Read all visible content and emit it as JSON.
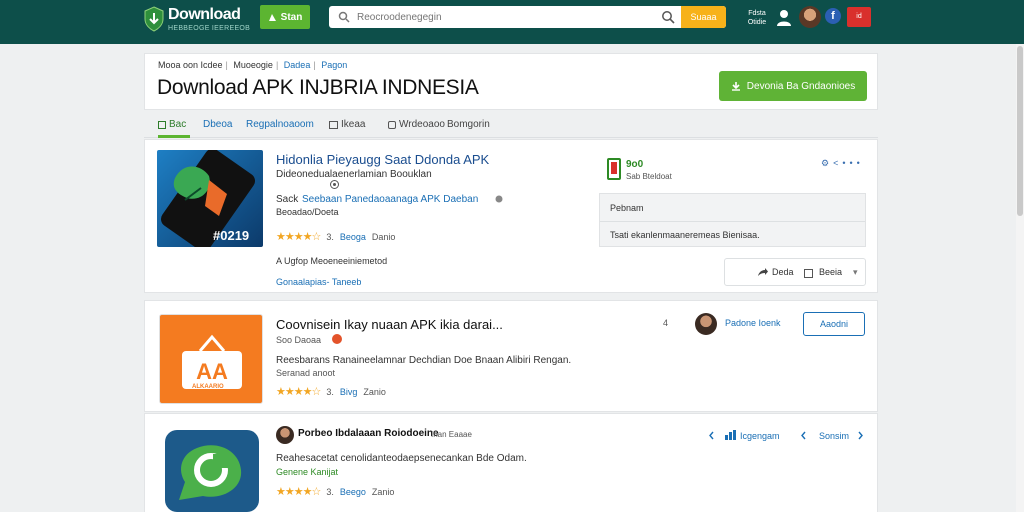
{
  "header": {
    "logo_title": "Download",
    "logo_sub": "HEBBEOGE IEEREEOB",
    "start_label": "Stan",
    "search_placeholder": "Reocroodenegegin",
    "search_button": "Suaaa",
    "header_text": "Fdsta Otidie",
    "lang": "id"
  },
  "breadcrumb": [
    "Mooa oon Icdee",
    "Muoeogie",
    "Dadea",
    "Pagon"
  ],
  "page_title": "Download APK INJBRIA INDNESIA",
  "download_button": "Devonia Ba Gndaonioes",
  "tabs": [
    {
      "label": "Bac",
      "style": "active"
    },
    {
      "label": "Dbeoa",
      "style": "link"
    },
    {
      "label": "Regpalnoaoom",
      "style": "link"
    },
    {
      "label": "Ikeaa",
      "style": "plain"
    },
    {
      "label": "Wrdeoaoo",
      "style": "plain"
    },
    {
      "label": "Bomgorin",
      "style": "plain"
    }
  ],
  "featured": {
    "title": "Hidonlia Pieyaugg Saat Ddonda APK",
    "subtitle": "Dideonedualaenerlamian Boouklan",
    "line1": "Sack",
    "line1_link": "Seebaan Panedaoaanaga APK  Daeban",
    "line2": "Beoadao/Doeta",
    "rating_num": "3.",
    "rating_label": "Beoga",
    "rating_count": "Danio",
    "note": "A  Ugfop Meoeneeiniemetod",
    "note_link": "Gonaalapias- Taneeb",
    "thumb_text": "#0219",
    "score_value": "9o0",
    "score_sub": "Sab Bteldoat",
    "panel_row1": "Pebnam",
    "panel_row2": "Tsati ekanlenmaaneremeas Bienisaa.",
    "share_label": "Deda",
    "report_label": "Beeia"
  },
  "items": [
    {
      "title": "Coovnisein Ikay nuaan APK ikia darai...",
      "meta": "Soo Daoaa",
      "count": "4",
      "author": "Padone Ioenk",
      "follow_label": "Aaodni",
      "desc": "Reesbarans Ranaineelamnar Dechdian Doe Bnaan Alibiri Rengan.",
      "desc2": "Seranad anoot",
      "rating_num": "3.",
      "rating_label": "Bivg",
      "rating_count": "Zanio",
      "thumb_text": "ALKAARIO"
    },
    {
      "title": "Porbeo Ibdalaaan Roiodoeine",
      "meta": "Ihan Eaaae",
      "action1": "Icgengam",
      "action2": "Sonsim",
      "desc": "Reahesacetat cenolidanteodaepsenecankan Bde Odam.",
      "desc2": "Genene Kanijat",
      "rating_num": "3.",
      "rating_label": "Beego",
      "rating_count": "Zanio"
    }
  ],
  "colors": {
    "header_bg": "#0d4f4a",
    "accent_green": "#5cb531",
    "accent_orange": "#f7b21a",
    "link_blue": "#1a6fb5"
  }
}
